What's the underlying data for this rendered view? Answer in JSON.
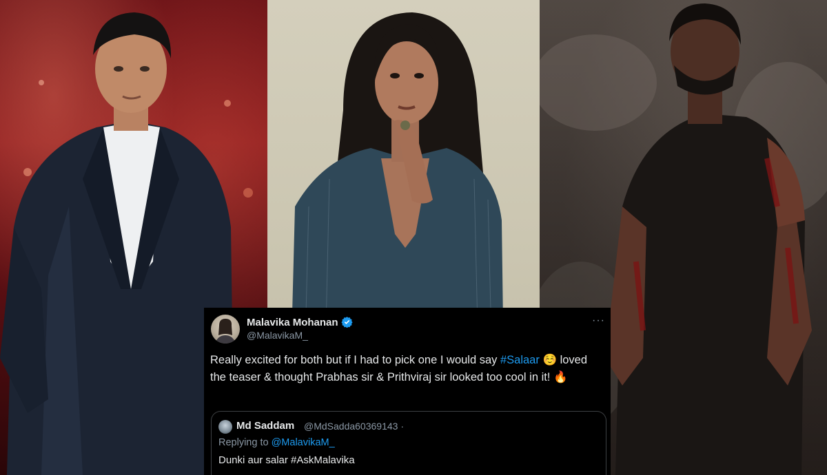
{
  "tweet": {
    "author_name": "Malavika Mohanan",
    "author_handle": "@MalavikaM_",
    "more_label": "···",
    "text_part1": "Really excited for both but if I had to pick one I would say ",
    "hashtag": "#Salaar",
    "emoji1": "☺️",
    "text_part2": " loved the teaser & thought Prabhas sir & Prithviraj sir looked too cool in it! ",
    "emoji2": "🔥",
    "quoted": {
      "author_name": "Md Saddam",
      "author_handle": "@MdSadda60369143 ·",
      "reply_prefix": "Replying to ",
      "reply_handle": "@MalavikaM_",
      "text": "Dunki aur salar #AskMalavika"
    }
  },
  "colors": {
    "tweet_bg": "#000000",
    "text": "#e7e9ea",
    "muted": "#8b98a5",
    "link": "#1d9bf0",
    "verified": "#1d9bf0"
  }
}
